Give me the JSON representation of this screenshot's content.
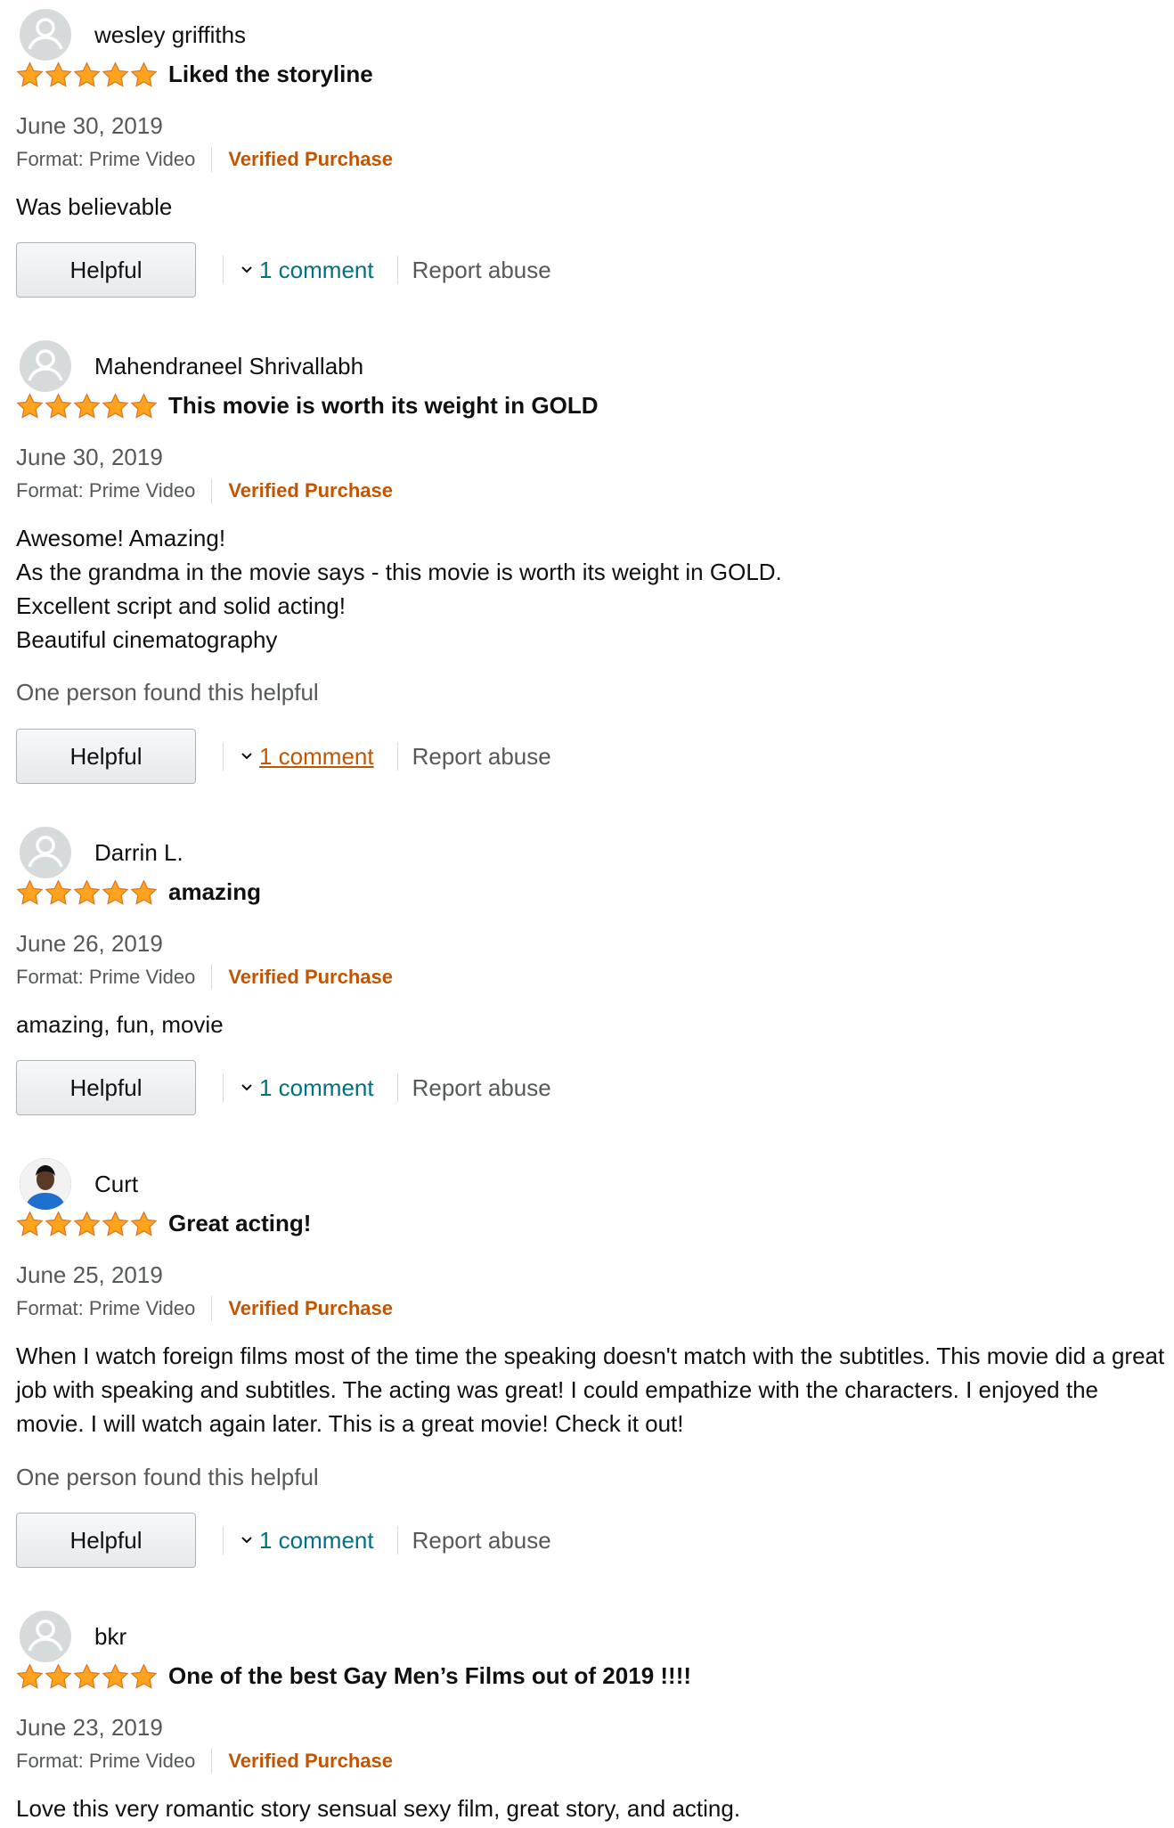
{
  "colors": {
    "star_fill": "#FFA41C",
    "star_stroke": "#DE7921",
    "verified": "#C45500",
    "link": "#007185",
    "link_hover": "#C45500",
    "muted": "#565959"
  },
  "labels": {
    "helpful_button": "Helpful",
    "report_abuse": "Report abuse",
    "format_prefix": "Format: Prime Video",
    "verified_purchase": "Verified Purchase"
  },
  "reviews": [
    {
      "author": "wesley griffiths",
      "avatar": "default-avatar-icon",
      "rating": 5,
      "title": "Liked the storyline",
      "date": "June 30, 2019",
      "body": [
        "Was believable"
      ],
      "helpful_count": "",
      "comments": "1 comment"
    },
    {
      "author": "Mahendraneel Shrivallabh",
      "avatar": "default-avatar-icon",
      "rating": 5,
      "title": "This movie is worth its weight in GOLD",
      "date": "June 30, 2019",
      "body": [
        "Awesome! Amazing!",
        "As the grandma in the movie says - this movie is worth its weight in GOLD.",
        "Excellent script and solid acting!",
        "Beautiful cinematography"
      ],
      "helpful_count": "One person found this helpful",
      "comments": "1 comment"
    },
    {
      "author": "Darrin L.",
      "avatar": "default-avatar-icon",
      "rating": 5,
      "title": "amazing",
      "date": "June 26, 2019",
      "body": [
        "amazing, fun, movie"
      ],
      "helpful_count": "",
      "comments": "1 comment"
    },
    {
      "author": "Curt",
      "avatar": "user-photo",
      "rating": 5,
      "title": "Great acting!",
      "date": "June 25, 2019",
      "body": [
        "When I watch foreign films most of the time the speaking doesn't match with the subtitles. This movie did a great job with speaking and subtitles. The acting was great! I could empathize with the characters. I enjoyed the movie. I will watch again later. This is a great movie! Check it out!"
      ],
      "helpful_count": "One person found this helpful",
      "comments": "1 comment"
    },
    {
      "author": "bkr",
      "avatar": "default-avatar-icon",
      "rating": 5,
      "title": "One of the best Gay Men’s Films out of 2019 !!!!",
      "date": "June 23, 2019",
      "body": [
        "Love this very romantic story sensual sexy film, great story, and acting."
      ],
      "helpful_count": "",
      "comments": ""
    }
  ]
}
